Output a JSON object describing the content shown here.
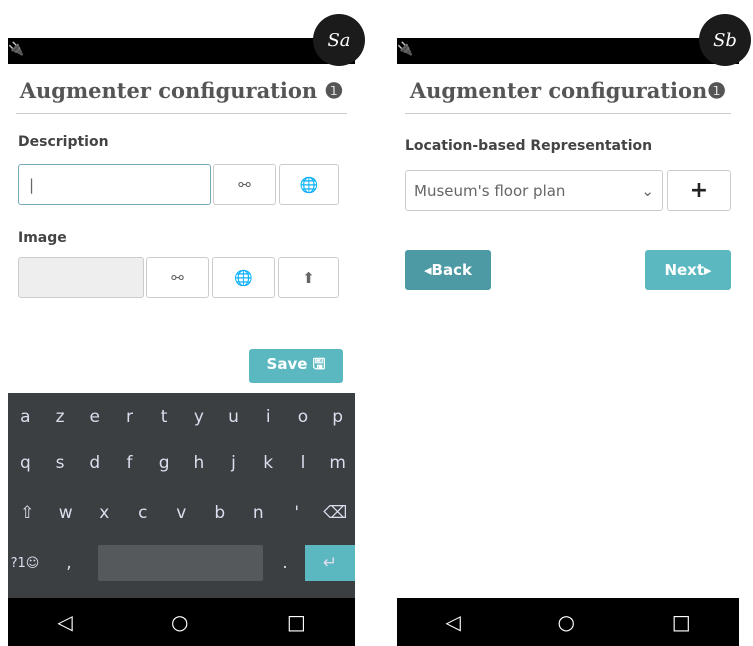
{
  "sa": {
    "badge": "Sa",
    "status_left": "🔌",
    "status_right": "★▼◢",
    "title": "Augmenter configuration ❶",
    "desc": "Description",
    "desc_cursor": "|",
    "image": "Image",
    "link": "⚯",
    "globe": "🌐",
    "upload": "⬆",
    "save": "Save 🖫",
    "keys_r1": [
      "a",
      "z",
      "e",
      "r",
      "t",
      "y",
      "u",
      "i",
      "o",
      "p"
    ],
    "keys_r2": [
      "q",
      "s",
      "d",
      "f",
      "g",
      "h",
      "j",
      "k",
      "l",
      "m"
    ],
    "keys_r3": [
      "⇧",
      "w",
      "x",
      "c",
      "v",
      "b",
      "n",
      "'",
      "⌫"
    ],
    "sym": "?1☺",
    "comma": ",",
    "dot": ".",
    "enter": "↵",
    "nav": [
      "◁",
      "○",
      "□"
    ]
  },
  "sb": {
    "badge": "Sb",
    "status_left": "🔌",
    "status_right": "★▼◢",
    "title": "Augmenter configuration❶",
    "loc": "Location-based Representation",
    "select": "Museum's floor plan",
    "plus": "+",
    "back": "◂Back",
    "next": "Next▸",
    "nav": [
      "◁",
      "○",
      "□"
    ]
  }
}
